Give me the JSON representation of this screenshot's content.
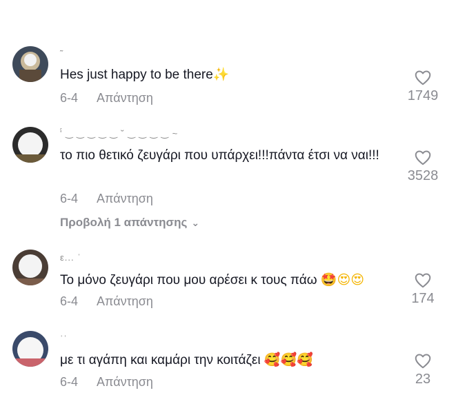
{
  "comments": [
    {
      "username": "˜",
      "text": "Hes just happy to be there",
      "emoji": "✨",
      "date": "6-4",
      "reply_label": "Απάντηση",
      "likes": "1749"
    },
    {
      "username": "'́́ ‿ ‿ ‿ ‿ ‿ ˘ ‿ ‿ ‿ ‿ ~",
      "text": "το πιο θετικό ζευγάρι που υπάρχει!!!πάντα έτσι να ναι!!!",
      "emoji": "",
      "date": "6-4",
      "reply_label": "Απάντηση",
      "likes": "3528",
      "view_replies": "Προβολή 1 απάντησης"
    },
    {
      "username": "ε...   ˈ",
      "text": "Το μόνο ζευγάρι που μου αρέσει κ τους πάω",
      "emoji": "🤩😍😍",
      "date": "6-4",
      "reply_label": "Απάντηση",
      "likes": "174"
    },
    {
      "username": "ˈˈ",
      "text": "με τι αγάπη και καμάρι την κοιτάζει",
      "emoji": "🥰🥰🥰",
      "date": "6-4",
      "reply_label": "Απάντηση",
      "likes": "23"
    }
  ]
}
